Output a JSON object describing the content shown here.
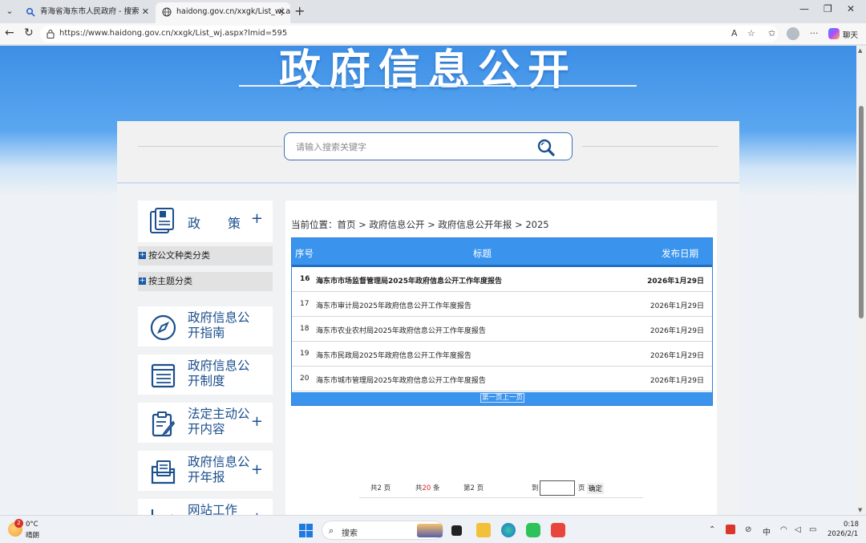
{
  "browser": {
    "tabs": [
      {
        "label": "青海省海东市人民政府 - 搜索",
        "active": false
      },
      {
        "label": "haidong.gov.cn/xxgk/List_wj.aspx?",
        "active": true
      }
    ],
    "url": "https://www.haidong.gov.cn/xxgk/List_wj.aspx?lmid=595",
    "chat_label": "聊天"
  },
  "banner": {
    "title": "政府信息公开"
  },
  "search": {
    "placeholder": "请输入搜索关键字"
  },
  "sidebar": {
    "policy": {
      "label": "政策"
    },
    "sub_items": [
      {
        "label": "按公文种类分类"
      },
      {
        "label": "按主题分类"
      }
    ],
    "items": [
      {
        "label": "政府信息公开指南",
        "has_plus": false
      },
      {
        "label": "政府信息公开制度",
        "has_plus": false
      },
      {
        "label": "法定主动公开内容",
        "has_plus": true
      },
      {
        "label": "政府信息公开年报",
        "has_plus": true
      },
      {
        "label": "网站工作",
        "has_plus": true
      }
    ]
  },
  "main": {
    "breadcrumb": "当前位置：首页 > 政府信息公开 > 政府信息公开年报 > 2025",
    "table": {
      "headers": {
        "no": "序号",
        "title": "标题",
        "date": "发布日期"
      },
      "rows": [
        {
          "no": "16",
          "title": "海东市市场监督管理局2025年政府信息公开工作年度报告",
          "date": "2026年1月29日",
          "bold": true
        },
        {
          "no": "17",
          "title": "海东市审计局2025年政府信息公开工作年度报告",
          "date": "2026年1月29日",
          "bold": false
        },
        {
          "no": "18",
          "title": "海东市农业农村局2025年政府信息公开工作年度报告",
          "date": "2026年1月29日",
          "bold": false
        },
        {
          "no": "19",
          "title": "海东市民政局2025年政府信息公开工作年度报告",
          "date": "2026年1月29日",
          "bold": false
        },
        {
          "no": "20",
          "title": "海东市城市管理局2025年政府信息公开工作年度报告",
          "date": "2026年1月29日",
          "bold": false
        }
      ],
      "footer_links": "第一页上一页"
    },
    "pager": {
      "total_pages_prefix": "共",
      "total_pages": "2",
      "total_pages_suffix": "页",
      "total_items_prefix": "共",
      "total_items": "20",
      "total_items_suffix": "条",
      "current_prefix": "第",
      "current_page": "2",
      "current_suffix": "页",
      "goto_label": "到",
      "goto_suffix": "页",
      "confirm_label": "确定"
    }
  },
  "taskbar": {
    "weather_badge": "2",
    "temperature": "0°C",
    "weather": "晴朗",
    "search_label": "搜索",
    "ime": "中",
    "time": "0:18",
    "date": "2026/2/1"
  }
}
